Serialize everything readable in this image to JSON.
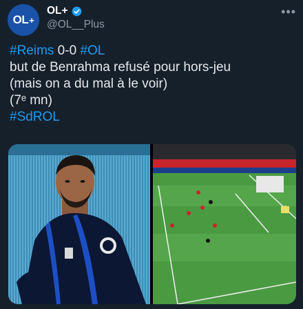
{
  "author": {
    "avatar_text": "OL",
    "avatar_plus": "+",
    "display_name": "OL+",
    "handle": "@OL__Plus",
    "verified": true,
    "verified_icon": "verified-badge-icon",
    "more_icon": "more-options-icon"
  },
  "tweet": {
    "line1": {
      "tag1": "#Reims",
      "score": " 0-0 ",
      "tag2": "#OL"
    },
    "line2": "but de Benrahma  refusé pour hors-jeu",
    "line3": "(mais on a du mal à le voir)",
    "line4": "(7ᵉ mn)",
    "line5": {
      "tag": "#SdROL"
    }
  },
  "media": {
    "left_image": "player-closeup-photo",
    "right_image": "offside-replay-photo"
  },
  "colors": {
    "background": "#15202b",
    "text": "#e7e9ea",
    "hashtag": "#1d9bf0",
    "secondary": "#8b98a5",
    "avatar": "#1a52a8",
    "verified": "#1d9bf0"
  }
}
